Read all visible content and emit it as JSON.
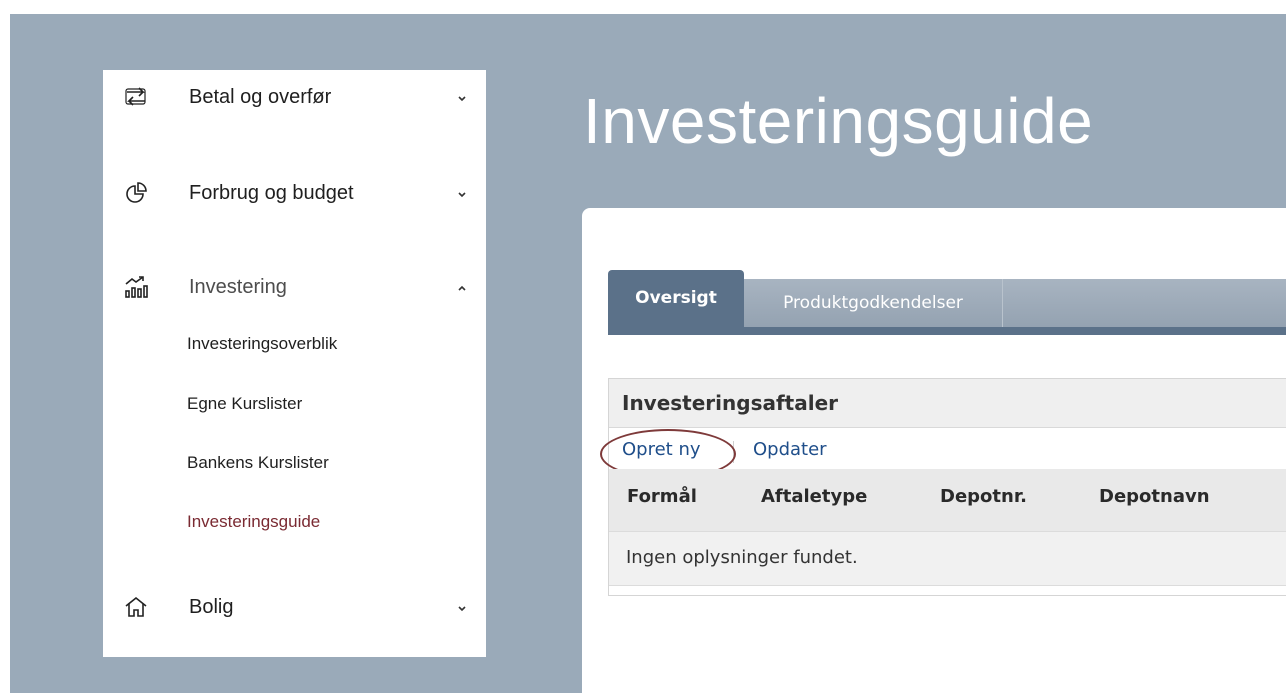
{
  "sidebar": {
    "items": [
      {
        "label": "Betal og overfør",
        "icon": "transfer-icon",
        "expanded": false
      },
      {
        "label": "Forbrug og budget",
        "icon": "pie-chart-icon",
        "expanded": false
      },
      {
        "label": "Investering",
        "icon": "investment-chart-icon",
        "expanded": true,
        "children": [
          {
            "label": "Investeringsoverblik",
            "active": false
          },
          {
            "label": "Egne Kurslister",
            "active": false
          },
          {
            "label": "Bankens Kurslister",
            "active": false
          },
          {
            "label": "Investeringsguide",
            "active": true
          }
        ]
      },
      {
        "label": "Bolig",
        "icon": "house-icon",
        "expanded": false
      }
    ]
  },
  "page": {
    "title": "Investeringsguide"
  },
  "tabs": [
    {
      "label": "Oversigt",
      "active": true
    },
    {
      "label": "Produktgodkendelser",
      "active": false
    }
  ],
  "panel": {
    "title": "Investeringsaftaler",
    "actions": {
      "create": "Opret ny",
      "refresh": "Opdater"
    },
    "columns": [
      "Formål",
      "Aftaletype",
      "Depotnr.",
      "Depotnavn"
    ],
    "empty_message": "Ingen oplysninger fundet."
  },
  "colors": {
    "backdrop": "#9aaab9",
    "active_tab": "#5b7189",
    "active_nav": "#7a2a32",
    "link": "#1f4e8a",
    "highlight_ring": "#7e3a3a"
  }
}
